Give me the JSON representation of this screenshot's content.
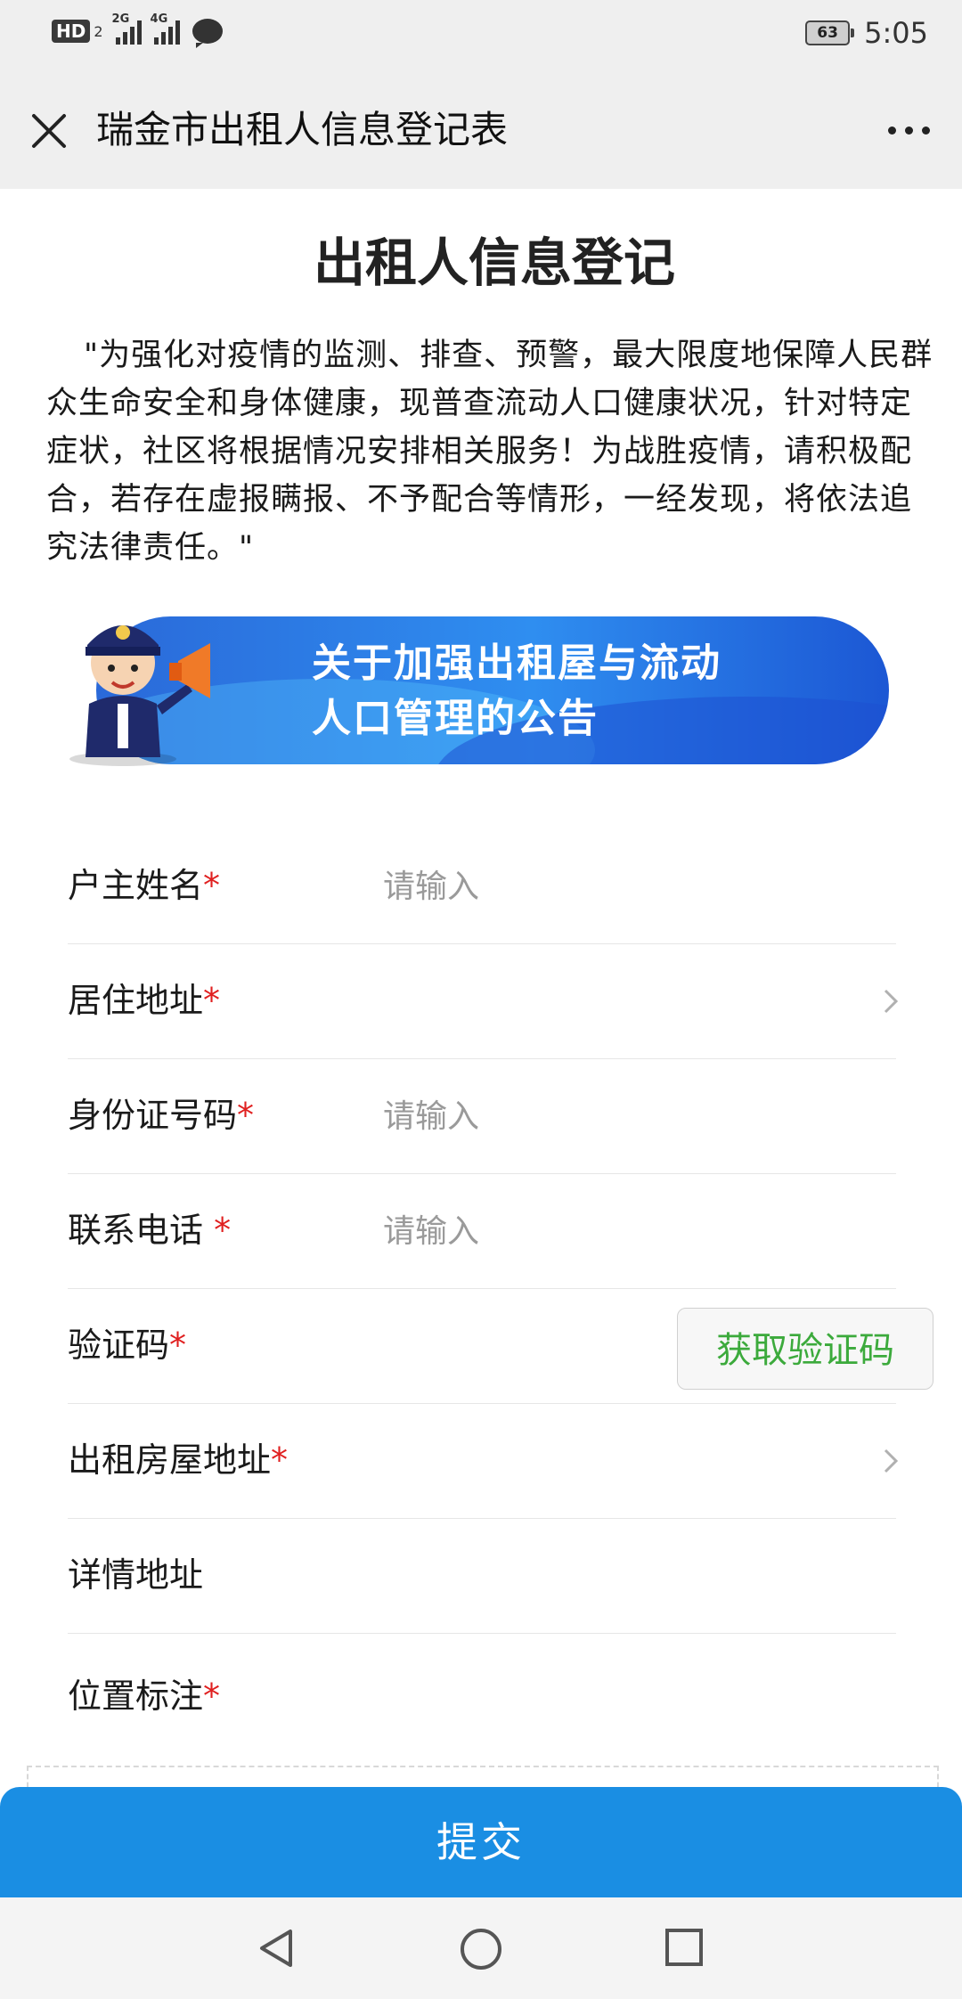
{
  "status_bar": {
    "hd_label": "HD",
    "hd_sub": "2",
    "signal1_gen": "2G",
    "signal2_gen": "4G",
    "battery": "63",
    "time": "5:05"
  },
  "header": {
    "title": "瑞金市出租人信息登记表"
  },
  "page": {
    "heading": "出租人信息登记",
    "intro": "\"为强化对疫情的监测、排查、预警，最大限度地保障人民群众生命安全和身体健康，现普查流动人口健康状况，针对特定症状，社区将根据情况安排相关服务！为战胜疫情，请积极配合，若存在虚报瞒报、不予配合等情形，一经发现，将依法追究法律责任。\"",
    "banner_line1": "关于加强出租屋与流动",
    "banner_line2": "人口管理的公告"
  },
  "form": {
    "fields": [
      {
        "label": "户主姓名",
        "required": "*",
        "placeholder": "请输入"
      },
      {
        "label": "居住地址",
        "required": "*"
      },
      {
        "label": "身份证号码",
        "required": "*",
        "placeholder": "请输入"
      },
      {
        "label": "联系电话 ",
        "required": "*",
        "placeholder": "请输入"
      },
      {
        "label": "验证码",
        "required": "*"
      },
      {
        "label": "出租房屋地址",
        "required": "*"
      },
      {
        "label": "详情地址",
        "required": ""
      },
      {
        "label": "位置标注",
        "required": "*"
      }
    ],
    "captcha_button": "获取验证码",
    "submit": "提交"
  },
  "colors": {
    "accent": "#1a8ee3",
    "required": "#e02020",
    "captcha_text": "#3caa3c"
  }
}
